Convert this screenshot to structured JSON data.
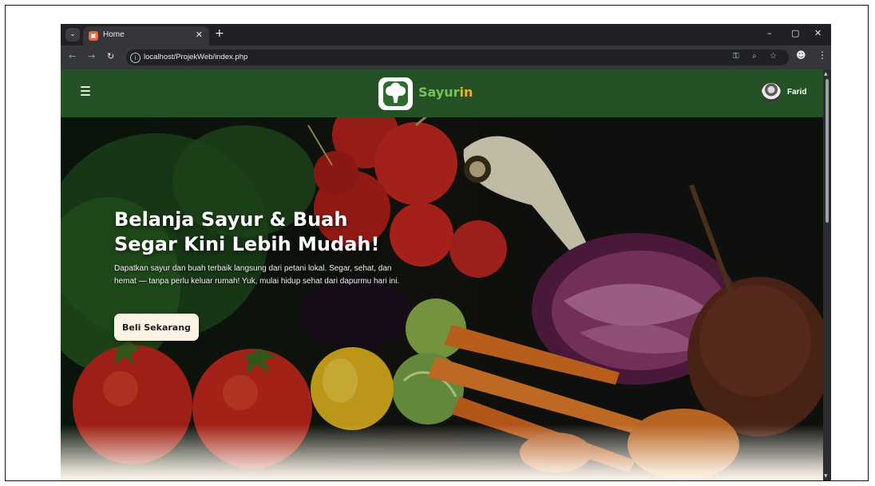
{
  "browser": {
    "tab_title": "Home",
    "url": "localhost/ProjekWeb/index.php"
  },
  "site": {
    "brand_part1": "Sayur",
    "brand_part2": "in",
    "user_name": "Farid",
    "colors": {
      "navbar": "#245126",
      "brand_green": "#77c257",
      "brand_orange": "#f0b21a"
    }
  },
  "hero": {
    "title_line1": "Belanja Sayur & Buah",
    "title_line2": "Segar Kini Lebih Mudah!",
    "description": "Dapatkan sayur dan buah terbaik langsung dari petani lokal. Segar, sehat, dan hemat — tanpa perlu keluar rumah! Yuk, mulai hidup sehat dari dapurmu hari ini.",
    "cta_label": "Beli Sekarang"
  },
  "icons": [
    "tab-menu-icon",
    "favicon-icon",
    "close-icon",
    "new-tab-icon",
    "minimize-icon",
    "restore-icon",
    "window-close-icon",
    "back-icon",
    "forward-icon",
    "reload-icon",
    "site-info-icon",
    "password-key-icon",
    "zoom-icon",
    "bookmark-star-icon",
    "profile-icon",
    "menu-dots-icon",
    "hamburger-icon",
    "broccoli-logo-icon",
    "avatar"
  ]
}
